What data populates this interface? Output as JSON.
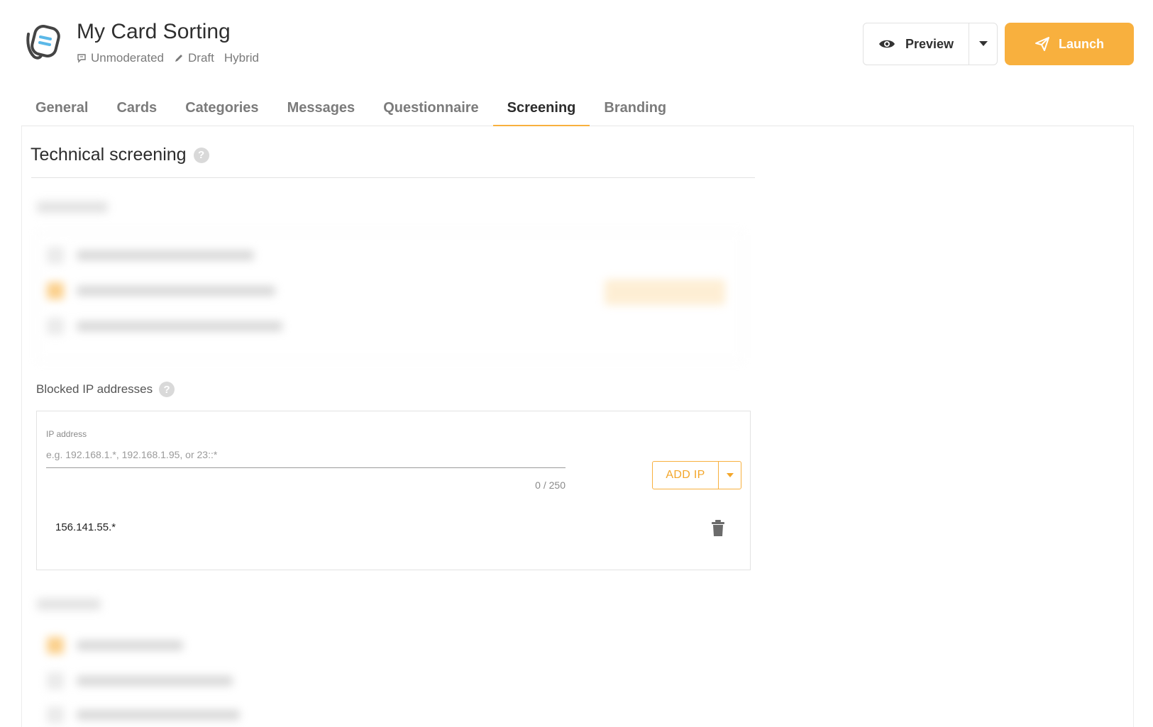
{
  "app": {
    "title": "My Card Sorting",
    "meta": [
      {
        "icon": "chat-bubble-icon",
        "label": "Unmoderated"
      },
      {
        "icon": "pencil-icon",
        "label": "Draft"
      },
      {
        "icon": "",
        "label": "Hybrid"
      }
    ]
  },
  "actions": {
    "preview_label": "Preview",
    "launch_label": "Launch"
  },
  "tabs": [
    {
      "label": "General",
      "active": false
    },
    {
      "label": "Cards",
      "active": false
    },
    {
      "label": "Categories",
      "active": false
    },
    {
      "label": "Messages",
      "active": false
    },
    {
      "label": "Questionnaire",
      "active": false
    },
    {
      "label": "Screening",
      "active": true
    },
    {
      "label": "Branding",
      "active": false
    }
  ],
  "section": {
    "title": "Technical screening",
    "help": "?"
  },
  "blocked_ip": {
    "label": "Blocked IP addresses",
    "help": "?",
    "field_label": "IP address",
    "placeholder": "e.g. 192.168.1.*, 192.168.1.95, or 23::*",
    "value": "",
    "counter": "0 / 250",
    "add_label": "ADD IP",
    "entries": [
      "156.141.55.*"
    ]
  },
  "colors": {
    "accent": "#f8b03e",
    "text_dark": "#2c2c2c",
    "text_muted": "#7b7b7b",
    "logo_blue": "#5bb8e8"
  }
}
